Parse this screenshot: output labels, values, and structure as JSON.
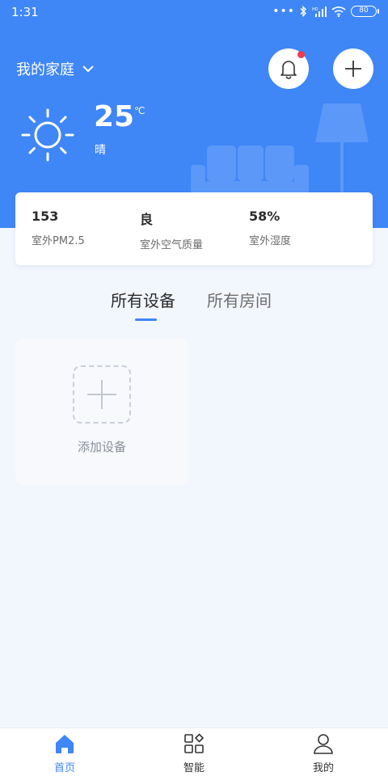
{
  "status_bar": {
    "time": "1:31",
    "battery": "80"
  },
  "header": {
    "home_name": "我的家庭"
  },
  "weather": {
    "temperature": "25",
    "unit": "℃",
    "description": "晴"
  },
  "stats": [
    {
      "value": "153",
      "label": "室外PM2.5"
    },
    {
      "value": "良",
      "label": "室外空气质量"
    },
    {
      "value": "58%",
      "label": "室外湿度"
    }
  ],
  "tabs": {
    "active": "所有设备",
    "inactive": "所有房间"
  },
  "add_device": {
    "label": "添加设备"
  },
  "bottom_nav": {
    "home": "首页",
    "smart": "智能",
    "me": "我的"
  },
  "colors": {
    "primary": "#3f86f6",
    "background": "#f2f6fd",
    "notification_dot": "#ef3b4a"
  },
  "icons": {
    "chevron": "chevron-down-icon",
    "bell": "bell-icon",
    "add": "plus-icon",
    "weather": "sun-icon",
    "home_nav": "home-icon",
    "smart_nav": "grid-icon",
    "me_nav": "person-icon"
  }
}
